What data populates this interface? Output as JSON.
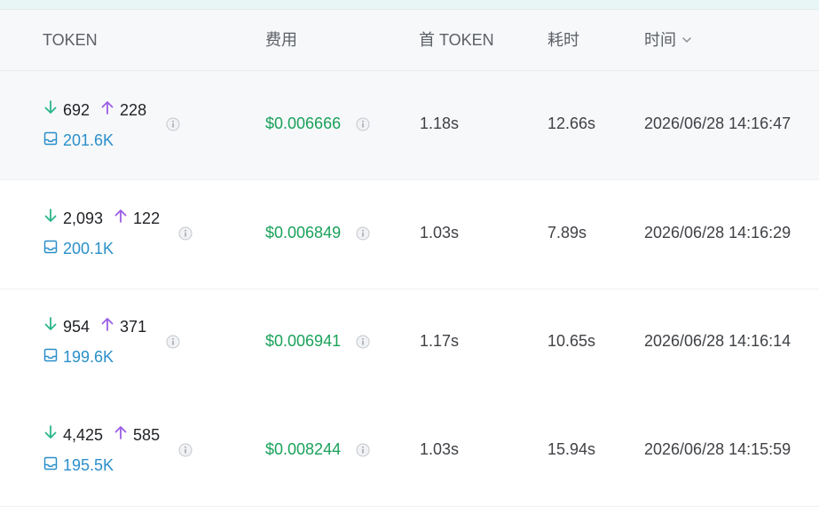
{
  "header": {
    "token": "TOKEN",
    "cost": "费用",
    "first_token": "首 TOKEN",
    "duration": "耗时",
    "time": "时间"
  },
  "rows": [
    {
      "input": "692",
      "output": "228",
      "cache": "201.6K",
      "cost": "$0.006666",
      "first_token": "1.18s",
      "duration": "12.66s",
      "time": "2026/06/28 14:16:47"
    },
    {
      "input": "2,093",
      "output": "122",
      "cache": "200.1K",
      "cost": "$0.006849",
      "first_token": "1.03s",
      "duration": "7.89s",
      "time": "2026/06/28 14:16:29"
    },
    {
      "input": "954",
      "output": "371",
      "cache": "199.6K",
      "cost": "$0.006941",
      "first_token": "1.17s",
      "duration": "10.65s",
      "time": "2026/06/28 14:16:14"
    },
    {
      "input": "4,425",
      "output": "585",
      "cache": "195.5K",
      "cost": "$0.008244",
      "first_token": "1.03s",
      "duration": "15.94s",
      "time": "2026/06/28 14:15:59"
    }
  ],
  "icons": {
    "input": "arrow-down-icon",
    "output": "arrow-up-icon",
    "cache": "inbox-icon",
    "info": "info-icon",
    "sort": "chevron-down-icon"
  },
  "colors": {
    "input_arrow": "#2bb58a",
    "output_arrow": "#9b5de5",
    "cache": "#2a8fc9",
    "price": "#1aa15a"
  }
}
